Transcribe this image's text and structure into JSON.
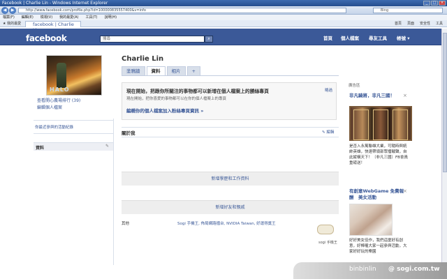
{
  "browser": {
    "window_title": "Facebook | Charlie Lin - Windows Internet Explorer",
    "url": "http://www.facebook.com/profile.php?id=100000835557400&v=info",
    "search_placeholder": "Bing",
    "menu": [
      "檔案(F)",
      "編輯(E)",
      "檢視(V)",
      "我的最愛(A)",
      "工具(T)",
      "說明(H)"
    ],
    "favorites_label": "我的最愛",
    "tab_label": "facebook | Charlie Lin",
    "commands": [
      "首頁",
      "頁面",
      "安全性",
      "工具"
    ]
  },
  "facebook": {
    "logo": "facebook",
    "search_placeholder": "搜尋",
    "nav": [
      "首頁",
      "個人檔案",
      "尋友工具",
      "帳號"
    ]
  },
  "profile": {
    "name": "Charlie Lin",
    "pic_caption": "HALO",
    "links": [
      "查看開心農場排行 (39)",
      "編輯個人檔案"
    ],
    "box_label": "你最近參與的活動紀錄",
    "info_label": "資料"
  },
  "tabs": [
    {
      "label": "塗鴉牆",
      "active": false
    },
    {
      "label": "資料",
      "active": true
    },
    {
      "label": "相片",
      "active": false
    },
    {
      "label": "+",
      "active": false
    }
  ],
  "notice": {
    "title": "現在開始，把跟你所關注的事物都可以新增在個人檔案上的勝絲專頁",
    "sub": "現在開始，把你喜愛的事物都可以在你的個人檔案上的專頁",
    "link": "編輯你的個人檔案加入粉絲專頁資訊 »",
    "skip": "略過"
  },
  "about": {
    "title": "關於我",
    "edit": "編輯"
  },
  "buttons": {
    "add_education": "新增學歷和工作資料",
    "add_friends": "新增好友和親戚"
  },
  "other": {
    "label": "其他",
    "value": "Sogi 手機王, 佈局網路擂台, NVIDIA Taiwan, 好運得獎王"
  },
  "ads": {
    "header": "廣告區",
    "items": [
      {
        "title": "非凡騎將，非凡三國！",
        "text": "是否入永萬聯雄大業，可隨時與統帥英雄，快速帶領部眾擂戰聲，自此縱橫天下！〔非凡三國〕FB會員重磅送！"
      },
      {
        "title": "有創意WebGame 免費報酬　美女活動",
        "text": "好好美女佳作，我們這麼好有創意，好棒喔大家一起參與活動，大家好好玩的樂園"
      }
    ]
  },
  "chat": {
    "label": "sogi 手機王"
  },
  "watermark": {
    "user": "binbinlin",
    "site": "@ sogi.com.tw"
  },
  "colors": {
    "fb_blue": "#3b5998",
    "link": "#3b5998",
    "panel": "#eeeeee"
  }
}
